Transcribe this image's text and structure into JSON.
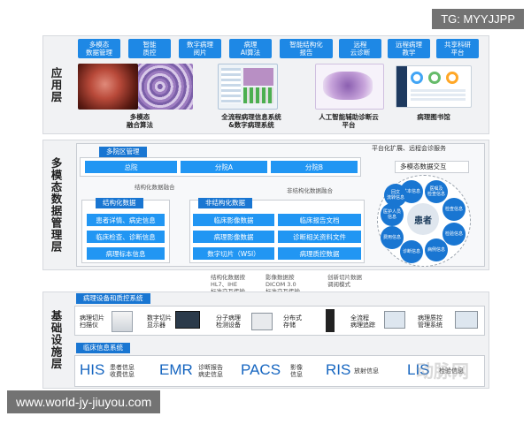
{
  "watermark_top": "TG: MYYJJPP",
  "watermark_bottom": "www.world-jy-jiuyou.com",
  "layers": {
    "app": "应用层",
    "data": "多模态数据管理层",
    "base": "基础设施层"
  },
  "app_tiles": [
    "多模态\n数据管理",
    "智能\n质控",
    "数字病理\n阅片",
    "病理\nAI算法",
    "智能结构化\n报告",
    "远程\n云诊断",
    "远程病理\n教学",
    "共享科研\n平台"
  ],
  "app_captions": [
    "多模态\n融合算法",
    "全流程病理信息系统\n&数字病理系统",
    "人工智能辅助诊断云\n平台",
    "病理图书馆"
  ],
  "data_layer": {
    "multi_hospital": "多院区管理",
    "branches": [
      "总院",
      "分院A",
      "分院B"
    ],
    "platform_note": "平台化扩展、远程会诊服务",
    "multimodal_exchange": "多模态数据交互",
    "structured_fusion": "结构化数据融合",
    "unstructured_fusion": "非结构化数据融合",
    "structured_title": "结构化数据",
    "structured_items": [
      "患者详情、病史信息",
      "临床检查、诊断信息",
      "病理标本信息"
    ],
    "unstructured_title": "非结构化数据",
    "unstructured_items": [
      "临床影像数据",
      "临床报告文档",
      "病理影像数据",
      "诊断相关资料文件",
      "数字切片（WSI）",
      "病理质控数据"
    ],
    "patient": "患者",
    "petals": [
      "基本信息",
      "医嘱及\n检查信息",
      "检查信息",
      "检验信息",
      "病例信息",
      "诊断信息",
      "费用信息",
      "医护人员\n信息",
      "回文\n流转信息"
    ]
  },
  "protocols": [
    "结构化数据按\nHL7、IHE\n标准交互传输",
    "影像数据按\nDICOM 3.0\n标准交互传输",
    "创新切片数据\n调阅模式"
  ],
  "devices_header": "病理设备和质控系统",
  "devices": [
    "病理切片\n扫描仪",
    "数字切片\n显示器",
    "分子病理\n检测设备",
    "分布式\n存储",
    "全流程\n病理追踪",
    "病理质控\n管理系统"
  ],
  "clinical_header": "临床信息系统",
  "systems": [
    {
      "name": "HIS",
      "desc": "患者信息\n收费信息"
    },
    {
      "name": "EMR",
      "desc": "诊断报告\n病史信息"
    },
    {
      "name": "PACS",
      "desc": "影像\n信息"
    },
    {
      "name": "RIS",
      "desc": "放射信息"
    },
    {
      "name": "LIS",
      "desc": "检验信息"
    }
  ],
  "corner_logo": "动脉网"
}
